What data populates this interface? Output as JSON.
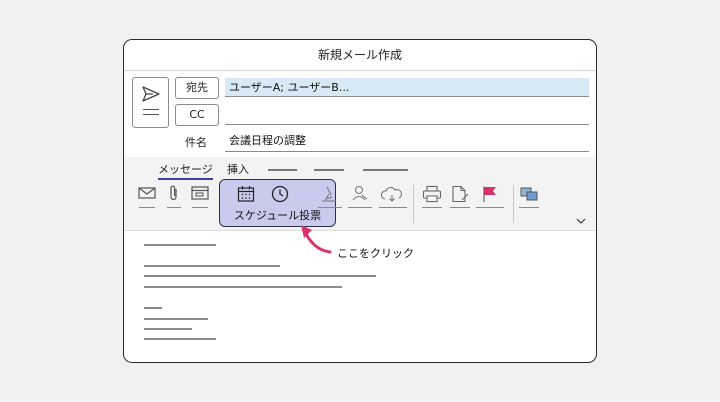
{
  "window": {
    "title": "新規メール作成"
  },
  "header": {
    "to_button": "宛先",
    "cc_button": "CC",
    "to_value": "ユーザーA; ユーザーB...",
    "cc_value": "",
    "subject_label": "件名",
    "subject_value": "会議日程の調整"
  },
  "ribbon": {
    "tabs": [
      {
        "label": "メッセージ",
        "active": true
      },
      {
        "label": "挿入",
        "active": false
      }
    ],
    "poll_button": {
      "label": "スケジュール投票",
      "icons": [
        "calendar-icon",
        "clock-icon"
      ]
    },
    "tools": [
      "mail-icon",
      "attach-icon",
      "card-icon",
      "pen-icon",
      "person-icon",
      "cloud-icon",
      "print-icon",
      "document-icon",
      "flag-icon",
      "translate-icon"
    ],
    "accent_color": "#3a3fb0",
    "flag_color": "#d6336c"
  },
  "annotation": {
    "label": "ここをクリック",
    "arrow_color": "#d6336c"
  }
}
